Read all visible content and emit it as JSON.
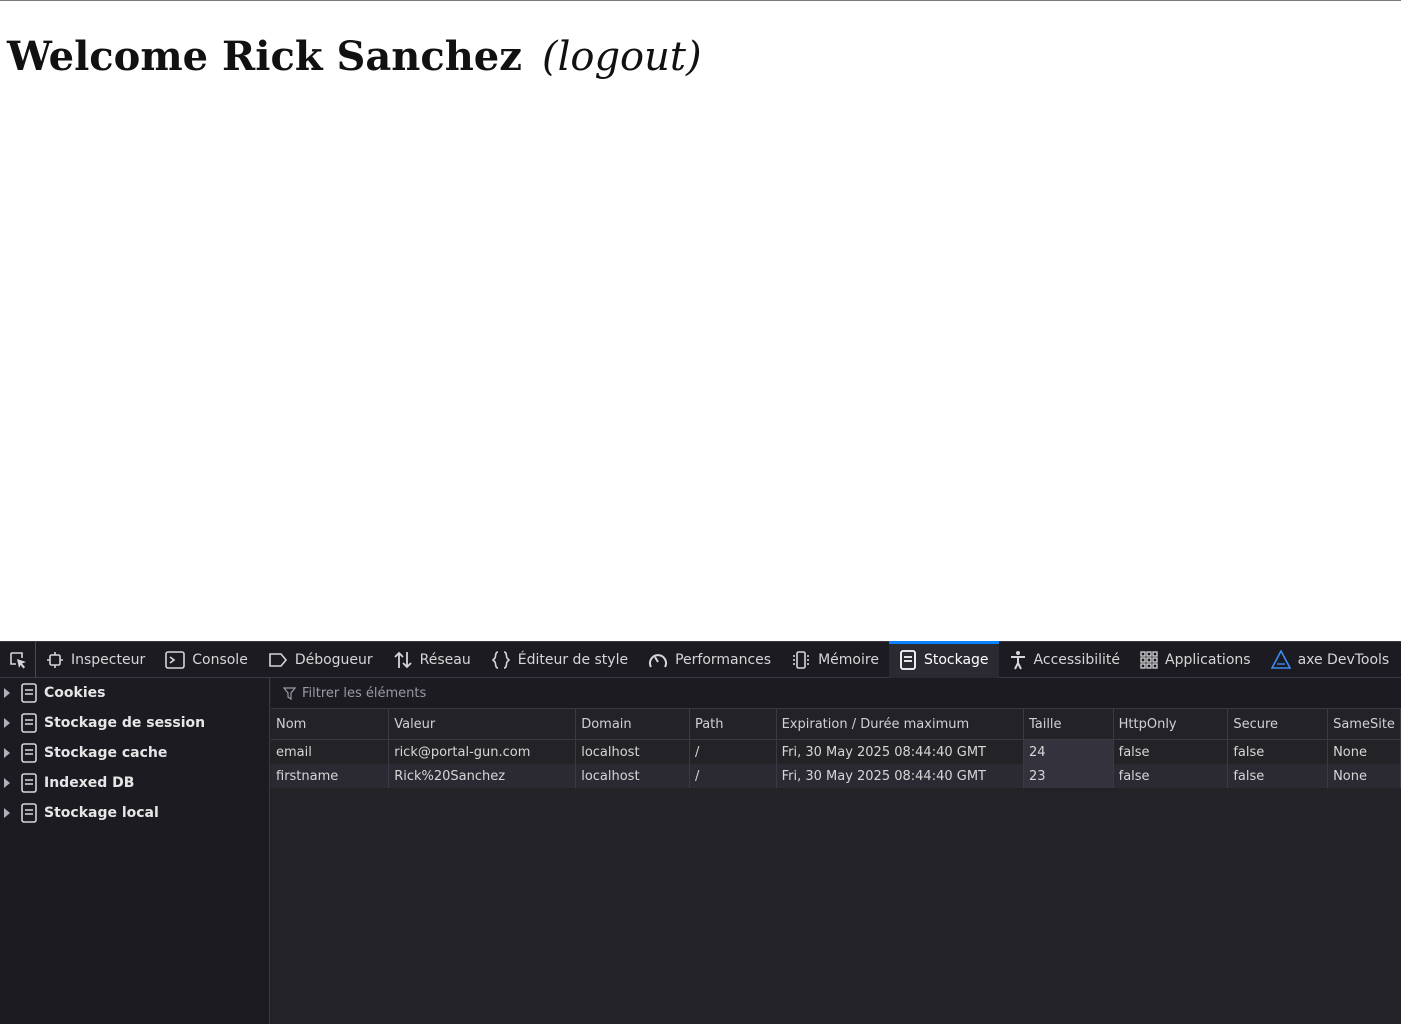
{
  "page": {
    "welcome_text": "Welcome Rick Sanchez",
    "logout_label": "(logout)"
  },
  "devtools": {
    "tabs": [
      {
        "label": "Inspecteur",
        "icon": "inspector-icon"
      },
      {
        "label": "Console",
        "icon": "console-icon"
      },
      {
        "label": "Débogueur",
        "icon": "debugger-icon"
      },
      {
        "label": "Réseau",
        "icon": "network-icon"
      },
      {
        "label": "Éditeur de style",
        "icon": "style-editor-icon"
      },
      {
        "label": "Performances",
        "icon": "performance-icon"
      },
      {
        "label": "Mémoire",
        "icon": "memory-icon"
      },
      {
        "label": "Stockage",
        "icon": "storage-icon"
      },
      {
        "label": "Accessibilité",
        "icon": "accessibility-icon"
      },
      {
        "label": "Applications",
        "icon": "applications-icon"
      },
      {
        "label": "axe DevTools",
        "icon": "axe-icon"
      }
    ],
    "active_tab": "Stockage",
    "sidebar": [
      "Cookies",
      "Stockage de session",
      "Stockage cache",
      "Indexed DB",
      "Stockage local"
    ],
    "filter_placeholder": "Filtrer les éléments",
    "columns": [
      "Nom",
      "Valeur",
      "Domain",
      "Path",
      "Expiration / Durée maximum",
      "Taille",
      "HttpOnly",
      "Secure",
      "SameSite"
    ],
    "rows": [
      [
        "email",
        "rick@portal-gun.com",
        "localhost",
        "/",
        "Fri, 30 May 2025 08:44:40 GMT",
        "24",
        "false",
        "false",
        "None"
      ],
      [
        "firstname",
        "Rick%20Sanchez",
        "localhost",
        "/",
        "Fri, 30 May 2025 08:44:40 GMT",
        "23",
        "false",
        "false",
        "None"
      ]
    ],
    "colors": {
      "accent": "#0a84ff",
      "panel_bg": "#232327",
      "toolbar_bg": "#1c1b22"
    }
  }
}
